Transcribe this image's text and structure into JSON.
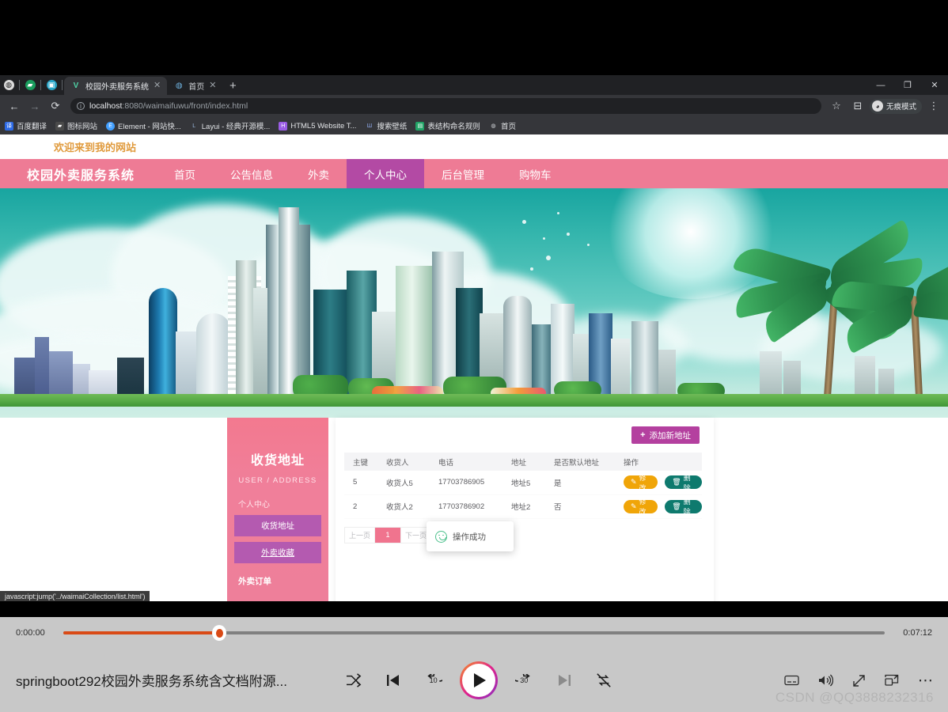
{
  "browser": {
    "quick_icons": [
      "globe-icon",
      "sheet-icon",
      "bilibili-icon"
    ],
    "tabs": [
      {
        "favicon": "V",
        "title": "校园外卖服务系统",
        "close": "✕",
        "active": true
      },
      {
        "favicon": "◍",
        "title": "首页",
        "close": "✕",
        "active": false
      }
    ],
    "new_tab_label": "+",
    "window_controls": {
      "minimize": "—",
      "maximize": "❐",
      "close": "✕"
    },
    "nav": {
      "back": "←",
      "forward": "→",
      "reload": "⟳"
    },
    "omnibox": {
      "info_glyph": "i",
      "url_host": "localhost",
      "url_rest": ":8080/waimaifuwu/front/index.html",
      "star": "☆",
      "reading_list": "⊟"
    },
    "incognito": {
      "icon_glyph": "◕",
      "label": "无痕模式"
    },
    "menu_label": "⋮",
    "bookmarks": [
      {
        "label": "百度翻译",
        "icon_color": "#2e6be6",
        "icon_glyph": "译"
      },
      {
        "label": "图标网站",
        "icon_color": "#4a4a4a",
        "icon_glyph": "▰"
      },
      {
        "label": "Element - 网站快...",
        "icon_color": "#409eff",
        "icon_glyph": "E"
      },
      {
        "label": "Layui - 经典开源模...",
        "icon_color": "#5a6b8c",
        "icon_glyph": "L"
      },
      {
        "label": "HTML5 Website T...",
        "icon_color": "#9b5de5",
        "icon_glyph": "H"
      },
      {
        "label": "搜索壁纸",
        "icon_color": "#3b5bdb",
        "icon_glyph": "Ш"
      },
      {
        "label": "表结构命名规则",
        "icon_color": "#21a366",
        "icon_glyph": "▤"
      },
      {
        "label": "首页",
        "icon_color": "#3b3b3b",
        "icon_glyph": "◍"
      }
    ]
  },
  "site": {
    "welcome": "欢迎来到我的网站",
    "nav": {
      "logo": "校园外卖服务系统",
      "items": [
        {
          "label": "首页",
          "active": false
        },
        {
          "label": "公告信息",
          "active": false
        },
        {
          "label": "外卖",
          "active": false
        },
        {
          "label": "个人中心",
          "active": true
        },
        {
          "label": "后台管理",
          "active": false
        },
        {
          "label": "购物车",
          "active": false
        }
      ]
    },
    "toast": {
      "icon": "smile-icon",
      "message": "操作成功"
    },
    "sidebar": {
      "title": "收货地址",
      "subtitle": "USER / ADDRESS",
      "group_label": "个人中心",
      "items": [
        {
          "label": "收货地址",
          "style": "filled"
        },
        {
          "label": "外卖收藏",
          "style": "filled-link"
        },
        {
          "label": "外卖订单",
          "style": "plain"
        }
      ]
    },
    "panel": {
      "add_button": {
        "plus": "+",
        "label": "添加新地址"
      },
      "table": {
        "headers": [
          "主键",
          "收货人",
          "电话",
          "地址",
          "是否默认地址",
          "操作"
        ],
        "rows": [
          {
            "id": "5",
            "receiver": "收货人5",
            "phone": "17703786905",
            "address": "地址5",
            "is_default": "是"
          },
          {
            "id": "2",
            "receiver": "收货人2",
            "phone": "17703786902",
            "address": "地址2",
            "is_default": "否"
          }
        ],
        "edit_label": "修改",
        "edit_icon": "✎",
        "delete_label": "删除",
        "delete_icon": "🗑"
      },
      "pagination": {
        "prev": "上一页",
        "current": "1",
        "next": "下一页"
      }
    },
    "status_bar": "javascript:jump('../waimaiCollection/list.html')"
  },
  "player": {
    "current_time": "0:00:00",
    "total_time": "0:07:12",
    "progress_percent": 19,
    "title": "springboot292校园外卖服务系统含文档附源...",
    "controls": {
      "shuffle": "⤬",
      "previous": "◀",
      "rewind_label": "10",
      "play": "▶",
      "forward_label": "30",
      "next": "▶",
      "repeat": "⇄"
    },
    "right_controls": {
      "subtitles": "▭",
      "volume": "🔊",
      "fullscreen": "⤢",
      "pip": "⧉",
      "more": "⋯"
    },
    "watermark": "CSDN @QQ3888232316"
  }
}
